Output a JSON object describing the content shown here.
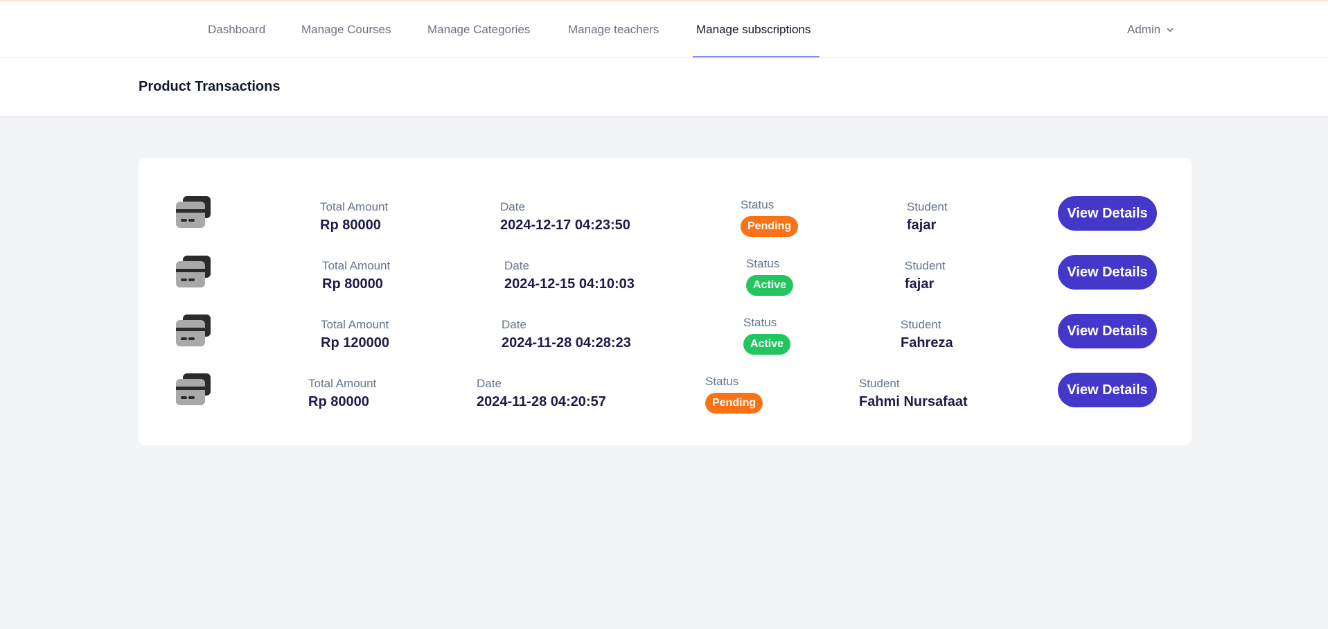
{
  "nav": {
    "items": [
      {
        "label": "Dashboard"
      },
      {
        "label": "Manage Courses"
      },
      {
        "label": "Manage Categories"
      },
      {
        "label": "Manage teachers"
      },
      {
        "label": "Manage subscriptions"
      }
    ],
    "active_index": 4,
    "user": {
      "name": "Admin"
    }
  },
  "header": {
    "title": "Product Transactions"
  },
  "transactions": {
    "labels": {
      "amount": "Total Amount",
      "date": "Date",
      "status": "Status",
      "student": "Student",
      "action": "View Details"
    },
    "rows": [
      {
        "amount": "Rp 80000",
        "date": "2024-12-17 04:23:50",
        "status": "Pending",
        "student": "fajar"
      },
      {
        "amount": "Rp 80000",
        "date": "2024-12-15 04:10:03",
        "status": "Active",
        "student": "fajar"
      },
      {
        "amount": "Rp 120000",
        "date": "2024-11-28 04:28:23",
        "status": "Active",
        "student": "Fahreza"
      },
      {
        "amount": "Rp 80000",
        "date": "2024-11-28 04:20:57",
        "status": "Pending",
        "student": "Fahmi Nursafaat"
      }
    ]
  },
  "colors": {
    "accent": "#4338ca",
    "pending": "#f97316",
    "active": "#22c55e",
    "nav_underline": "#818cf8"
  },
  "icons": {
    "transaction": "credit-cards-icon",
    "dropdown": "chevron-down-icon"
  }
}
